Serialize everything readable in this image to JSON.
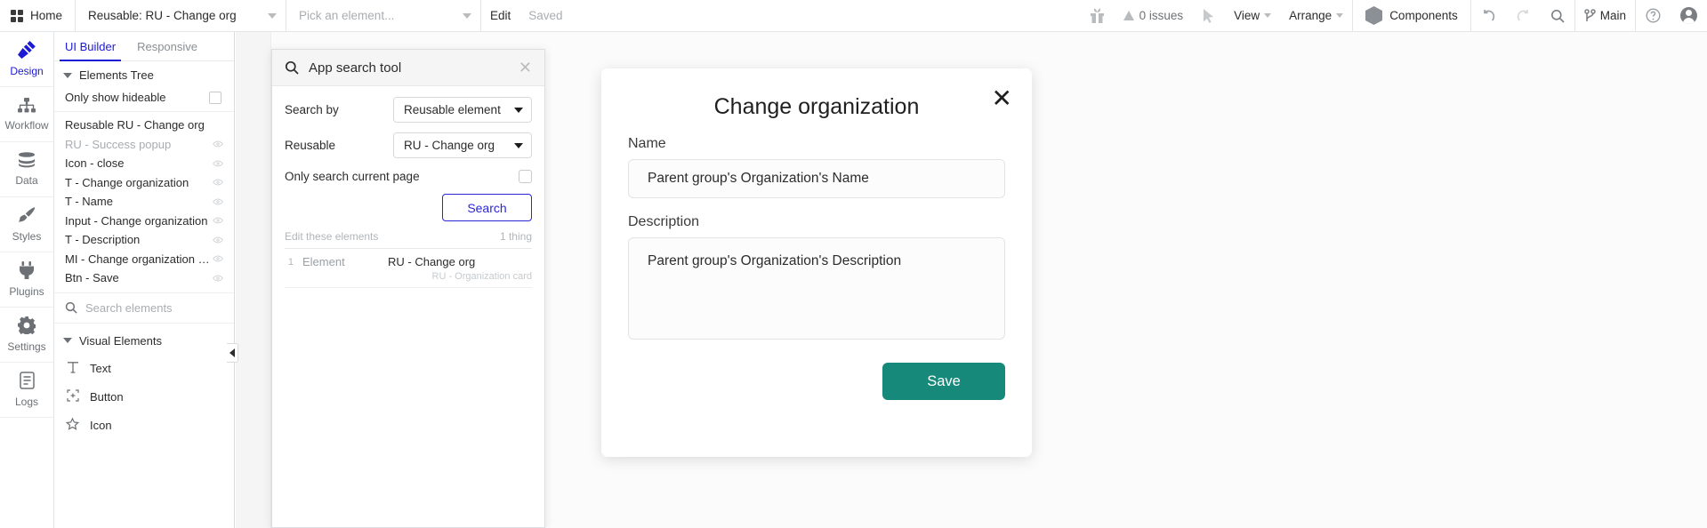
{
  "topbar": {
    "home_label": "Home",
    "app_selector": "Reusable: RU - Change org",
    "element_picker": "Pick an element...",
    "edit_label": "Edit",
    "saved_label": "Saved",
    "issues_label": "0 issues",
    "view_label": "View",
    "arrange_label": "Arrange",
    "components_label": "Components",
    "branch_label": "Main",
    "gift_icon": "gift-icon",
    "pointer_icon": "pointer-icon",
    "undo_icon": "undo-icon",
    "redo_icon": "redo-icon",
    "search_icon": "search-icon",
    "help_icon": "help-icon",
    "account_icon": "account-avatar-icon"
  },
  "rail": {
    "items": [
      {
        "label": "Design",
        "icon": "design-icon",
        "glyph": "✎",
        "active": true
      },
      {
        "label": "Workflow",
        "icon": "workflow-icon",
        "glyph": "⛓",
        "active": false
      },
      {
        "label": "Data",
        "icon": "data-icon",
        "glyph": "≣",
        "active": false
      },
      {
        "label": "Styles",
        "icon": "styles-brush-icon",
        "glyph": "✍",
        "active": false
      },
      {
        "label": "Plugins",
        "icon": "plugins-plug-icon",
        "glyph": "⑂",
        "active": false
      },
      {
        "label": "Settings",
        "icon": "settings-gear-icon",
        "glyph": "⚙",
        "active": false
      },
      {
        "label": "Logs",
        "icon": "logs-icon",
        "glyph": "☷",
        "active": false
      }
    ]
  },
  "panel": {
    "tabs": [
      {
        "label": "UI Builder",
        "active": true
      },
      {
        "label": "Responsive",
        "active": false
      }
    ],
    "elements_tree_label": "Elements Tree",
    "only_show_hideable_label": "Only show hideable",
    "tree_items": [
      {
        "label": "Reusable RU - Change org",
        "dim": false,
        "eye": false
      },
      {
        "label": "RU - Success popup",
        "dim": true,
        "eye": true
      },
      {
        "label": "Icon - close",
        "dim": false,
        "eye": true
      },
      {
        "label": "T - Change organization",
        "dim": false,
        "eye": true
      },
      {
        "label": "T - Name",
        "dim": false,
        "eye": true
      },
      {
        "label": "Input - Change organization",
        "dim": false,
        "eye": true
      },
      {
        "label": "T - Description",
        "dim": false,
        "eye": true
      },
      {
        "label": "MI - Change organization d...",
        "dim": false,
        "eye": true
      },
      {
        "label": "Btn - Save",
        "dim": false,
        "eye": true
      }
    ],
    "search_elements_placeholder": "Search elements",
    "visual_elements_label": "Visual Elements",
    "visual_elements": [
      {
        "label": "Text",
        "icon": "text-icon",
        "glyph": "T"
      },
      {
        "label": "Button",
        "icon": "button-icon",
        "glyph": "⊕"
      },
      {
        "label": "Icon",
        "icon": "star-icon",
        "glyph": "☆"
      }
    ]
  },
  "search_dialog": {
    "title": "App search tool",
    "search_icon": "search-icon",
    "close_icon": "close-icon",
    "search_by_label": "Search by",
    "search_by_value": "Reusable element",
    "reusable_label": "Reusable",
    "reusable_value": "RU - Change org",
    "only_current_page_label": "Only search current page",
    "search_button_label": "Search",
    "edit_these_elements_label": "Edit these elements",
    "result_count_label": "1 thing",
    "results": [
      {
        "index": "1",
        "type": "Element",
        "name": "RU - Change org",
        "sub": "RU - Organization card"
      }
    ]
  },
  "modal_preview": {
    "title": "Change organization",
    "close_icon": "close-icon",
    "name_label": "Name",
    "name_value": "Parent group's Organization's Name",
    "description_label": "Description",
    "description_value": "Parent group's Organization's Description",
    "save_label": "Save",
    "save_color": "#16897a"
  }
}
